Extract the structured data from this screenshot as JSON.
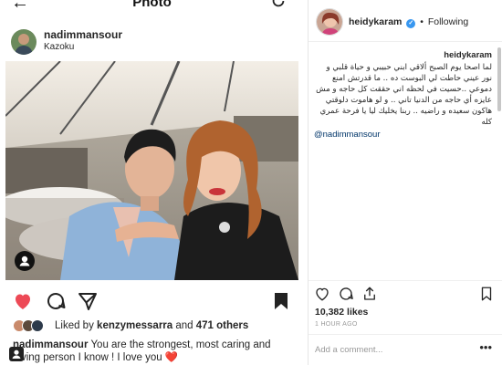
{
  "top_bar": {
    "title": "Photo"
  },
  "post": {
    "username": "nadimmansour",
    "location": "Kazoku",
    "likes": {
      "prefix": "Liked by",
      "liker": "kenzymessarra",
      "connector": "and",
      "others": "471 others"
    },
    "caption": {
      "username": "nadimmansour",
      "text": "You are the strongest, most caring and loving person I know ! I love you",
      "emoji": "❤️"
    }
  },
  "desktop_post": {
    "header": {
      "username": "heidykaram",
      "separator": "•",
      "follow_status": "Following"
    },
    "caption": {
      "username": "heidykaram",
      "text": "لما اصحا يوم الصبح ألاقي ابني حبيبي و حياة قلبي و نور عيني حاطت لي البوست ده .. ما قدرتش امنع دموعي ..حسيت في لحظه اني حققت كل حاجه و مش عايزه أي حاجه من الدنيا تاني .. و لو هاموت دلوقتي هاكون سعيده و راضيه .. ربنا يخليك ليا يا فرحة عمري كله",
      "mention": "@nadimmansour"
    },
    "likes": "10,382 likes",
    "time": "1 HOUR AGO",
    "comment_placeholder": "Add a comment...",
    "more": "•••"
  },
  "icons": {
    "back": "back-arrow-icon",
    "refresh": "refresh-icon",
    "like": "heart-icon",
    "comment": "comment-icon",
    "share": "share-icon",
    "save": "bookmark-icon",
    "upload": "upload-icon",
    "verified": "verified-badge-icon"
  },
  "colors": {
    "like_active": "#ed4956",
    "verified": "#3897f0",
    "mention": "#003569",
    "muted": "#999999"
  }
}
